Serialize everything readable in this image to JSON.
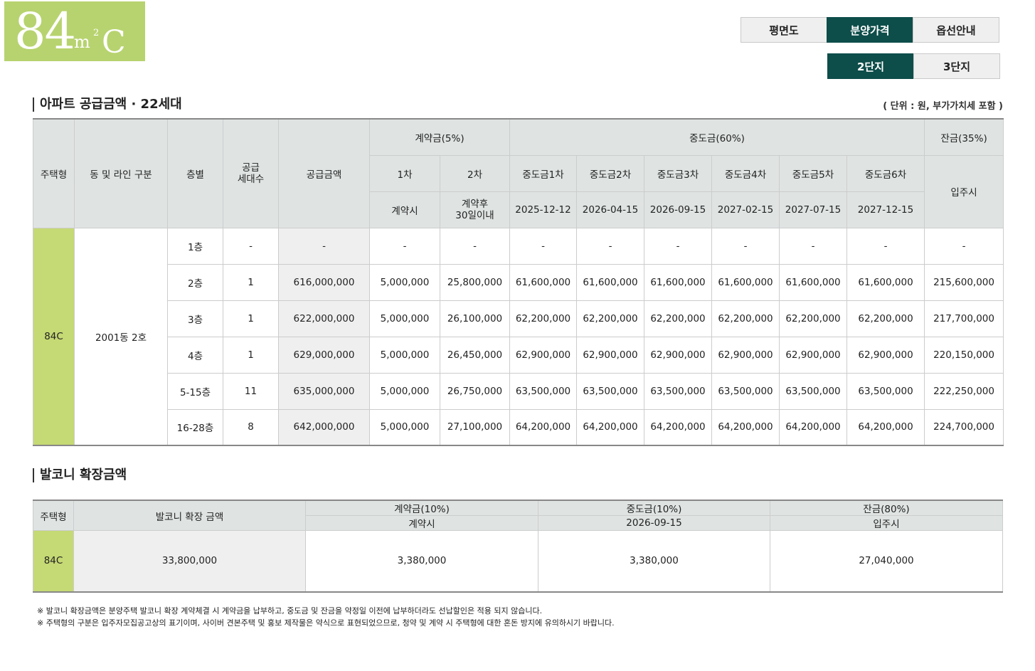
{
  "badge": {
    "number": "84",
    "unit": "m",
    "sup": "2",
    "type": "C"
  },
  "tabs_top": [
    "평면도",
    "분양가격",
    "옵선안내"
  ],
  "tabs_sub": [
    "2단지",
    "3단지"
  ],
  "apt_section": {
    "title": "아파트 공급금액 · 22세대",
    "unit_note": "( 단위 : 원, 부가가치세 포함 )"
  },
  "apt_headers": {
    "type": "주택형",
    "line": "동 및 라인 구분",
    "floor": "층별",
    "households": "공급\n세대수",
    "supply": "공급금액",
    "contract": "계약금(5%)",
    "middle": "중도금(60%)",
    "balance": "잔금(35%)",
    "c1": "1차",
    "c2": "2차",
    "m1": "중도금1차",
    "m2": "중도금2차",
    "m3": "중도금3차",
    "m4": "중도금4차",
    "m5": "중도금5차",
    "m6": "중도금6차",
    "move_in": "입주시",
    "c1_when": "계약시",
    "c2_when": "계약후\n30일이내",
    "d1": "2025-12-12",
    "d2": "2026-04-15",
    "d3": "2026-09-15",
    "d4": "2027-02-15",
    "d5": "2027-07-15",
    "d6": "2027-12-15"
  },
  "apt_group": {
    "type": "84C",
    "line": "2001동 2호"
  },
  "apt_rows": [
    {
      "floor": "1층",
      "households": "-",
      "supply": "-",
      "c1": "-",
      "c2": "-",
      "m1": "-",
      "m2": "-",
      "m3": "-",
      "m4": "-",
      "m5": "-",
      "m6": "-",
      "balance": "-"
    },
    {
      "floor": "2층",
      "households": "1",
      "supply": "616,000,000",
      "c1": "5,000,000",
      "c2": "25,800,000",
      "m1": "61,600,000",
      "m2": "61,600,000",
      "m3": "61,600,000",
      "m4": "61,600,000",
      "m5": "61,600,000",
      "m6": "61,600,000",
      "balance": "215,600,000"
    },
    {
      "floor": "3층",
      "households": "1",
      "supply": "622,000,000",
      "c1": "5,000,000",
      "c2": "26,100,000",
      "m1": "62,200,000",
      "m2": "62,200,000",
      "m3": "62,200,000",
      "m4": "62,200,000",
      "m5": "62,200,000",
      "m6": "62,200,000",
      "balance": "217,700,000"
    },
    {
      "floor": "4층",
      "households": "1",
      "supply": "629,000,000",
      "c1": "5,000,000",
      "c2": "26,450,000",
      "m1": "62,900,000",
      "m2": "62,900,000",
      "m3": "62,900,000",
      "m4": "62,900,000",
      "m5": "62,900,000",
      "m6": "62,900,000",
      "balance": "220,150,000"
    },
    {
      "floor": "5-15층",
      "households": "11",
      "supply": "635,000,000",
      "c1": "5,000,000",
      "c2": "26,750,000",
      "m1": "63,500,000",
      "m2": "63,500,000",
      "m3": "63,500,000",
      "m4": "63,500,000",
      "m5": "63,500,000",
      "m6": "63,500,000",
      "balance": "222,250,000"
    },
    {
      "floor": "16-28층",
      "households": "8",
      "supply": "642,000,000",
      "c1": "5,000,000",
      "c2": "27,100,000",
      "m1": "64,200,000",
      "m2": "64,200,000",
      "m3": "64,200,000",
      "m4": "64,200,000",
      "m5": "64,200,000",
      "m6": "64,200,000",
      "balance": "224,700,000"
    }
  ],
  "balcony_section": {
    "title": "발코니 확장금액"
  },
  "balcony_headers": {
    "type": "주택형",
    "amount": "발코니 확장 금액",
    "contract": "계약금(10%)",
    "middle": "중도금(10%)",
    "balance": "잔금(80%)",
    "contract_when": "계약시",
    "middle_when": "2026-09-15",
    "balance_when": "입주시"
  },
  "balcony_row": {
    "type": "84C",
    "amount": "33,800,000",
    "contract": "3,380,000",
    "middle": "3,380,000",
    "balance": "27,040,000"
  },
  "notes": [
    "※ 발코니 확장금액은 분양주택 발코니 확장 계약체결 시 계약금을 납부하고, 중도금 및 잔금을 약정일 이전에 납부하더라도 선납할인은 적용 되지 않습니다.",
    "※ 주택형의 구분은 입주자모집공고상의 표기이며, 사이버 견본주택 및 홍보 제작물은 약식으로 표현되었으므로, 청약 및 계약 시 주택형에 대한 혼돈 방지에 유의하시기 바랍니다."
  ],
  "colors": {
    "accent_green": "#b7d36f",
    "active_tab": "#0d4d4a",
    "header_bg": "#dfe4e3",
    "type_cell": "#c5d974"
  }
}
